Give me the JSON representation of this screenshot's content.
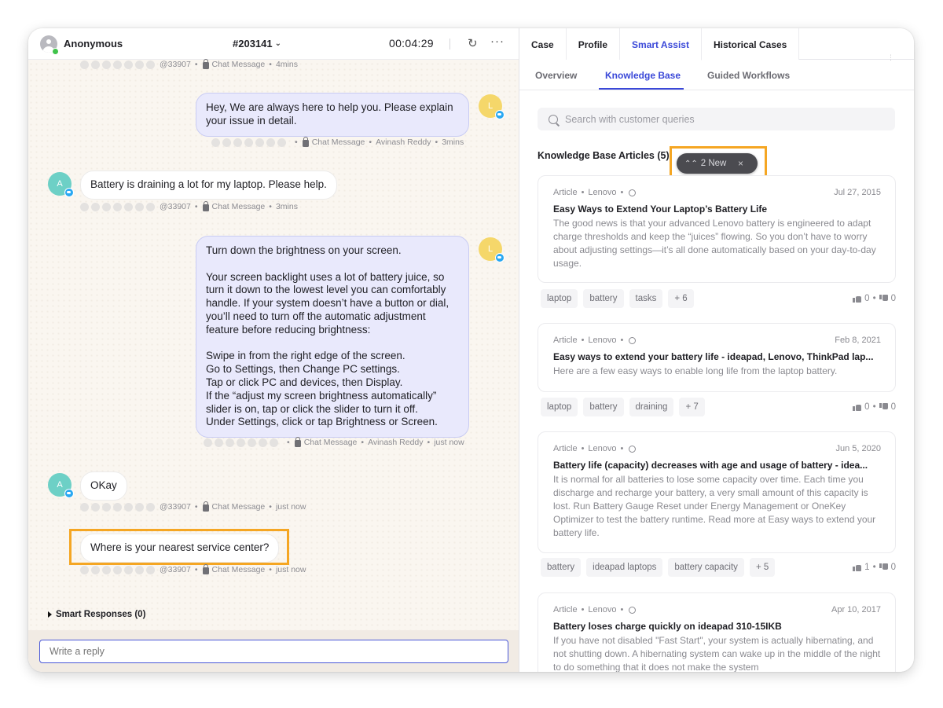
{
  "chat_header": {
    "user_name": "Anonymous",
    "ticket_id": "#203141",
    "timer": "00:04:29",
    "refresh_icon": "refresh-icon",
    "more_icon": "more-horizontal-icon"
  },
  "messages": [
    {
      "type": "meta-only",
      "meta": {
        "handle": "@33907",
        "channel": "Chat Message",
        "time": "4mins"
      }
    },
    {
      "type": "agent",
      "avatar_letter": "L",
      "text": "Hey, We are always here to help you. Please explain your issue in detail.",
      "meta": {
        "channel": "Chat Message",
        "author": "Avinash Reddy",
        "time": "3mins"
      }
    },
    {
      "type": "customer",
      "avatar_letter": "A",
      "text": "Battery is draining a lot for my laptop. Please help.",
      "meta": {
        "handle": "@33907",
        "channel": "Chat Message",
        "time": "3mins"
      }
    },
    {
      "type": "agent",
      "avatar_letter": "L",
      "text": "Turn down the brightness on your screen.\n\nYour screen backlight uses a lot of battery juice, so turn it down to the lowest level you can comfortably handle. If your system doesn’t have a button or dial, you’ll need to turn off the automatic adjustment feature before reducing brightness:\n\nSwipe in from the right edge of the screen.\nGo to Settings, then Change PC settings.\nTap or click PC and devices, then Display.\nIf the “adjust my screen brightness automatically” slider is on, tap or click the slider to turn it off.\nUnder Settings, click or tap Brightness or Screen.",
      "meta": {
        "channel": "Chat Message",
        "author": "Avinash Reddy",
        "time": "just now"
      }
    },
    {
      "type": "customer",
      "avatar_letter": "A",
      "text": "OKay",
      "meta": {
        "handle": "@33907",
        "channel": "Chat Message",
        "time": "just now"
      }
    },
    {
      "type": "customer",
      "text": "Where is your nearest service center?",
      "highlighted": true,
      "meta": {
        "handle": "@33907",
        "channel": "Chat Message",
        "time": "just now"
      }
    }
  ],
  "smart_responses": {
    "label": "Smart Responses (0)"
  },
  "composer": {
    "placeholder": "Write a reply"
  },
  "side_tabs": [
    {
      "label": "Case",
      "active": false
    },
    {
      "label": "Profile",
      "active": false
    },
    {
      "label": "Smart Assist",
      "active": true
    },
    {
      "label": "Historical Cases",
      "active": false
    }
  ],
  "sub_tabs": [
    {
      "label": "Overview",
      "active": false
    },
    {
      "label": "Knowledge Base",
      "active": true
    },
    {
      "label": "Guided Workflows",
      "active": false
    }
  ],
  "search": {
    "placeholder": "Search with customer queries"
  },
  "knowledge_base": {
    "title": "Knowledge Base Articles (5)",
    "new_pill": {
      "label": "2 New",
      "close": "×"
    },
    "articles": [
      {
        "type": "Article",
        "source": "Lenovo",
        "date": "Jul 27, 2015",
        "title": "Easy Ways to Extend Your Laptop’s Battery Life",
        "body": "The good news is that your advanced Lenovo battery is engineered to adapt charge thresholds and keep the “juices” flowing. So you don’t have to worry about adjusting settings—it’s all done automatically based on your day-to-day usage.",
        "tags": [
          "laptop",
          "battery",
          "tasks",
          "+ 6"
        ],
        "likes": "0",
        "dislikes": "0"
      },
      {
        "type": "Article",
        "source": "Lenovo",
        "date": "Feb 8, 2021",
        "title": "Easy ways to extend your battery life - ideapad, Lenovo, ThinkPad lap...",
        "body": "Here are a few easy ways to enable long life from the laptop battery.",
        "tags": [
          "laptop",
          "battery",
          "draining",
          "+ 7"
        ],
        "likes": "0",
        "dislikes": "0"
      },
      {
        "type": "Article",
        "source": "Lenovo",
        "date": "Jun 5, 2020",
        "title": "Battery life (capacity) decreases with age and usage of battery - idea...",
        "body": "It is normal for all batteries to lose some capacity over time. Each time you discharge and recharge your battery, a very small amount of this capacity is lost. Run Battery Gauge Reset under Energy Management or OneKey Optimizer to test the battery runtime. Read more at Easy ways to extend your battery life.",
        "tags": [
          "battery",
          "ideapad laptops",
          "battery capacity",
          "+ 5"
        ],
        "likes": "1",
        "dislikes": "0"
      },
      {
        "type": "Article",
        "source": "Lenovo",
        "date": "Apr 10, 2017",
        "title": "Battery loses charge quickly on ideapad 310-15IKB",
        "body": "If you have not disabled \"Fast Start\", your system is actually hibernating, and not shutting down.  A hibernating system can wake up in the middle of the night to do something that it does not make the system",
        "tags": [],
        "likes": "",
        "dislikes": ""
      }
    ]
  },
  "colors": {
    "accent": "#3a48d8",
    "highlight": "#f5a623",
    "agent_bubble": "#e9e9fc",
    "agent_avatar": "#f5d76a",
    "customer_avatar": "#6dd0c6",
    "presence": "#3fc34a"
  }
}
